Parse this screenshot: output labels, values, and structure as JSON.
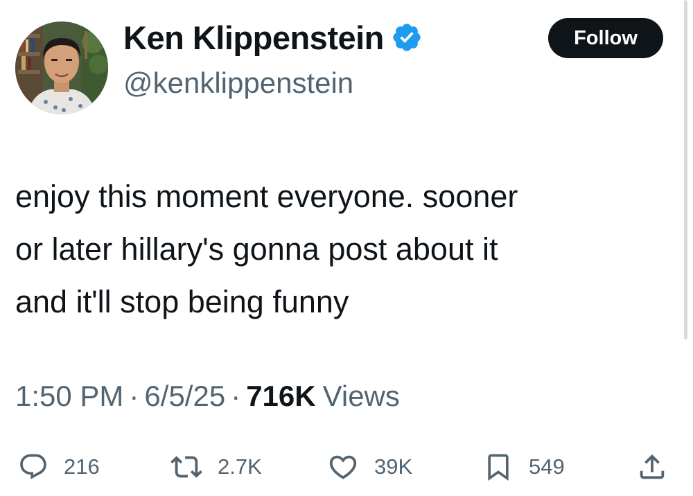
{
  "tweet": {
    "author": {
      "display_name": "Ken Klippenstein",
      "handle": "@kenklippenstein",
      "verified_icon": "verified-badge-icon",
      "avatar_icon": "avatar"
    },
    "follow_label": "Follow",
    "text": "enjoy this moment everyone. sooner\nor later hillary's gonna post about it\nand it'll stop being funny",
    "time": "1:50 PM",
    "separator": "·",
    "date": "6/5/25",
    "views_count": "716K",
    "views_label": "Views",
    "actions": {
      "replies": "216",
      "reposts": "2.7K",
      "likes": "39K",
      "bookmarks": "549"
    }
  },
  "colors": {
    "text_primary": "#0f1419",
    "text_secondary": "#536471",
    "verified_blue": "#1d9bf0",
    "follow_bg": "#0f1419"
  }
}
